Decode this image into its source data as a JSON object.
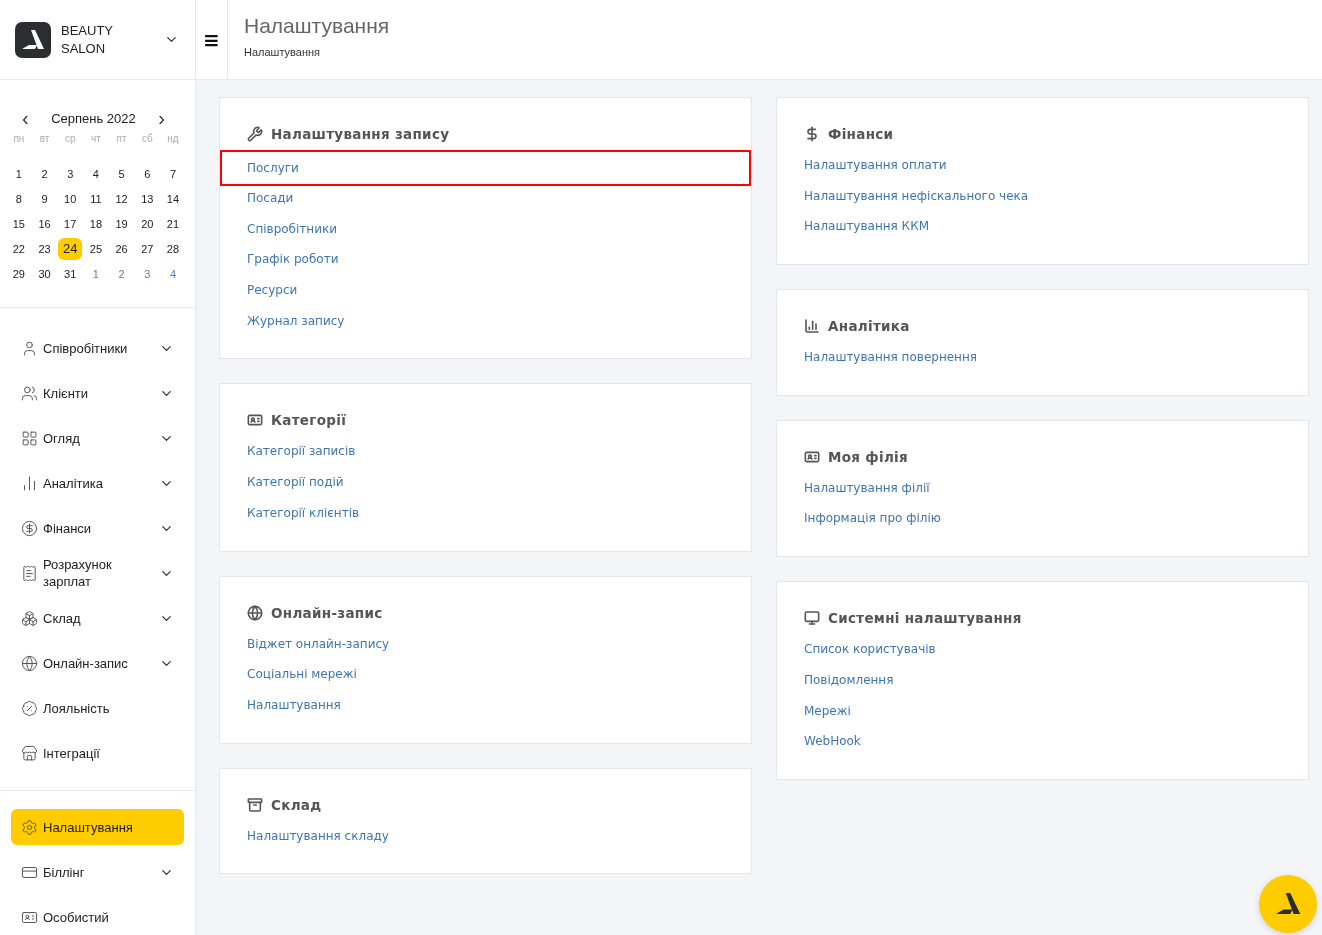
{
  "brand": {
    "name": "BEAUTY SALON"
  },
  "header": {
    "title": "Налаштування",
    "breadcrumb": "Налаштування",
    "menu_glyph": "≡"
  },
  "calendar": {
    "month": "Серпень 2022",
    "prev": "‹",
    "next": "›",
    "weekdays": [
      "пн",
      "вт",
      "ср",
      "чт",
      "пт",
      "сб",
      "нд"
    ],
    "days": [
      {
        "label": "1",
        "selected": false,
        "other_month": false
      },
      {
        "label": "2",
        "selected": false,
        "other_month": false
      },
      {
        "label": "3",
        "selected": false,
        "other_month": false
      },
      {
        "label": "4",
        "selected": false,
        "other_month": false
      },
      {
        "label": "5",
        "selected": false,
        "other_month": false
      },
      {
        "label": "6",
        "selected": false,
        "other_month": false
      },
      {
        "label": "7",
        "selected": false,
        "other_month": false
      },
      {
        "label": "8",
        "selected": false,
        "other_month": false
      },
      {
        "label": "9",
        "selected": false,
        "other_month": false
      },
      {
        "label": "10",
        "selected": false,
        "other_month": false
      },
      {
        "label": "11",
        "selected": false,
        "other_month": false
      },
      {
        "label": "12",
        "selected": false,
        "other_month": false
      },
      {
        "label": "13",
        "selected": false,
        "other_month": false
      },
      {
        "label": "14",
        "selected": false,
        "other_month": false
      },
      {
        "label": "15",
        "selected": false,
        "other_month": false
      },
      {
        "label": "16",
        "selected": false,
        "other_month": false
      },
      {
        "label": "17",
        "selected": false,
        "other_month": false
      },
      {
        "label": "18",
        "selected": false,
        "other_month": false
      },
      {
        "label": "19",
        "selected": false,
        "other_month": false
      },
      {
        "label": "20",
        "selected": false,
        "other_month": false
      },
      {
        "label": "21",
        "selected": false,
        "other_month": false
      },
      {
        "label": "22",
        "selected": false,
        "other_month": false
      },
      {
        "label": "23",
        "selected": false,
        "other_month": false
      },
      {
        "label": "24",
        "selected": true,
        "other_month": false
      },
      {
        "label": "25",
        "selected": false,
        "other_month": false
      },
      {
        "label": "26",
        "selected": false,
        "other_month": false
      },
      {
        "label": "27",
        "selected": false,
        "other_month": false
      },
      {
        "label": "28",
        "selected": false,
        "other_month": false
      },
      {
        "label": "29",
        "selected": false,
        "other_month": false
      },
      {
        "label": "30",
        "selected": false,
        "other_month": false
      },
      {
        "label": "31",
        "selected": false,
        "other_month": false
      },
      {
        "label": "1",
        "selected": false,
        "other_month": true
      },
      {
        "label": "2",
        "selected": false,
        "other_month": true
      },
      {
        "label": "3",
        "selected": false,
        "other_month": true
      },
      {
        "label": "4",
        "selected": false,
        "other_month": true
      }
    ]
  },
  "sidebar": {
    "items": [
      {
        "label": "Співробітники",
        "expandable": true,
        "selected": false
      },
      {
        "label": "Клієнти",
        "expandable": true,
        "selected": false
      },
      {
        "label": "Огляд",
        "expandable": true,
        "selected": false
      },
      {
        "label": "Аналітика",
        "expandable": true,
        "selected": false
      },
      {
        "label": "Фінанси",
        "expandable": true,
        "selected": false
      },
      {
        "label": "Розрахунок зарплат",
        "expandable": true,
        "selected": false
      },
      {
        "label": "Склад",
        "expandable": true,
        "selected": false
      },
      {
        "label": "Онлайн-запис",
        "expandable": true,
        "selected": false
      },
      {
        "label": "Лояльність",
        "expandable": false,
        "selected": false
      },
      {
        "label": "Інтеграції",
        "expandable": false,
        "selected": false
      }
    ],
    "bottom_items": [
      {
        "label": "Налаштування",
        "expandable": false,
        "selected": true
      },
      {
        "label": "Біллінг",
        "expandable": true,
        "selected": false
      },
      {
        "label": "Особистий",
        "expandable": false,
        "selected": false
      }
    ]
  },
  "columns": [
    [
      {
        "title": "Налаштування запису",
        "links": [
          {
            "label": "Послуги",
            "highlighted": true
          },
          {
            "label": "Посади",
            "highlighted": false
          },
          {
            "label": "Співробітники",
            "highlighted": false
          },
          {
            "label": "Графік роботи",
            "highlighted": false
          },
          {
            "label": "Ресурси",
            "highlighted": false
          },
          {
            "label": "Журнал запису",
            "highlighted": false
          }
        ]
      },
      {
        "title": "Категорії",
        "links": [
          {
            "label": "Категорії записів",
            "highlighted": false
          },
          {
            "label": "Категорії подій",
            "highlighted": false
          },
          {
            "label": "Категорії клієнтів",
            "highlighted": false
          }
        ]
      },
      {
        "title": "Онлайн-запис",
        "links": [
          {
            "label": "Віджет онлайн-запису",
            "highlighted": false
          },
          {
            "label": "Соціальні мережі",
            "highlighted": false
          },
          {
            "label": "Налаштування",
            "highlighted": false
          }
        ]
      },
      {
        "title": "Склад",
        "links": [
          {
            "label": "Налаштування складу",
            "highlighted": false
          }
        ]
      }
    ],
    [
      {
        "title": "Фінанси",
        "links": [
          {
            "label": "Налаштування оплати",
            "highlighted": false
          },
          {
            "label": "Налаштування нефіскального чека",
            "highlighted": false
          },
          {
            "label": "Налаштування ККМ",
            "highlighted": false
          }
        ]
      },
      {
        "title": "Аналітика",
        "links": [
          {
            "label": "Налаштування повернення",
            "highlighted": false
          }
        ]
      },
      {
        "title": "Моя філія",
        "links": [
          {
            "label": "Налаштування філії",
            "highlighted": false
          },
          {
            "label": "Інформація про філію",
            "highlighted": false
          }
        ]
      },
      {
        "title": "Системні налаштування",
        "links": [
          {
            "label": "Список користувачів",
            "highlighted": false
          },
          {
            "label": "Повідомлення",
            "highlighted": false
          },
          {
            "label": "Мережі",
            "highlighted": false
          },
          {
            "label": "WebHook",
            "highlighted": false
          }
        ]
      }
    ]
  ]
}
